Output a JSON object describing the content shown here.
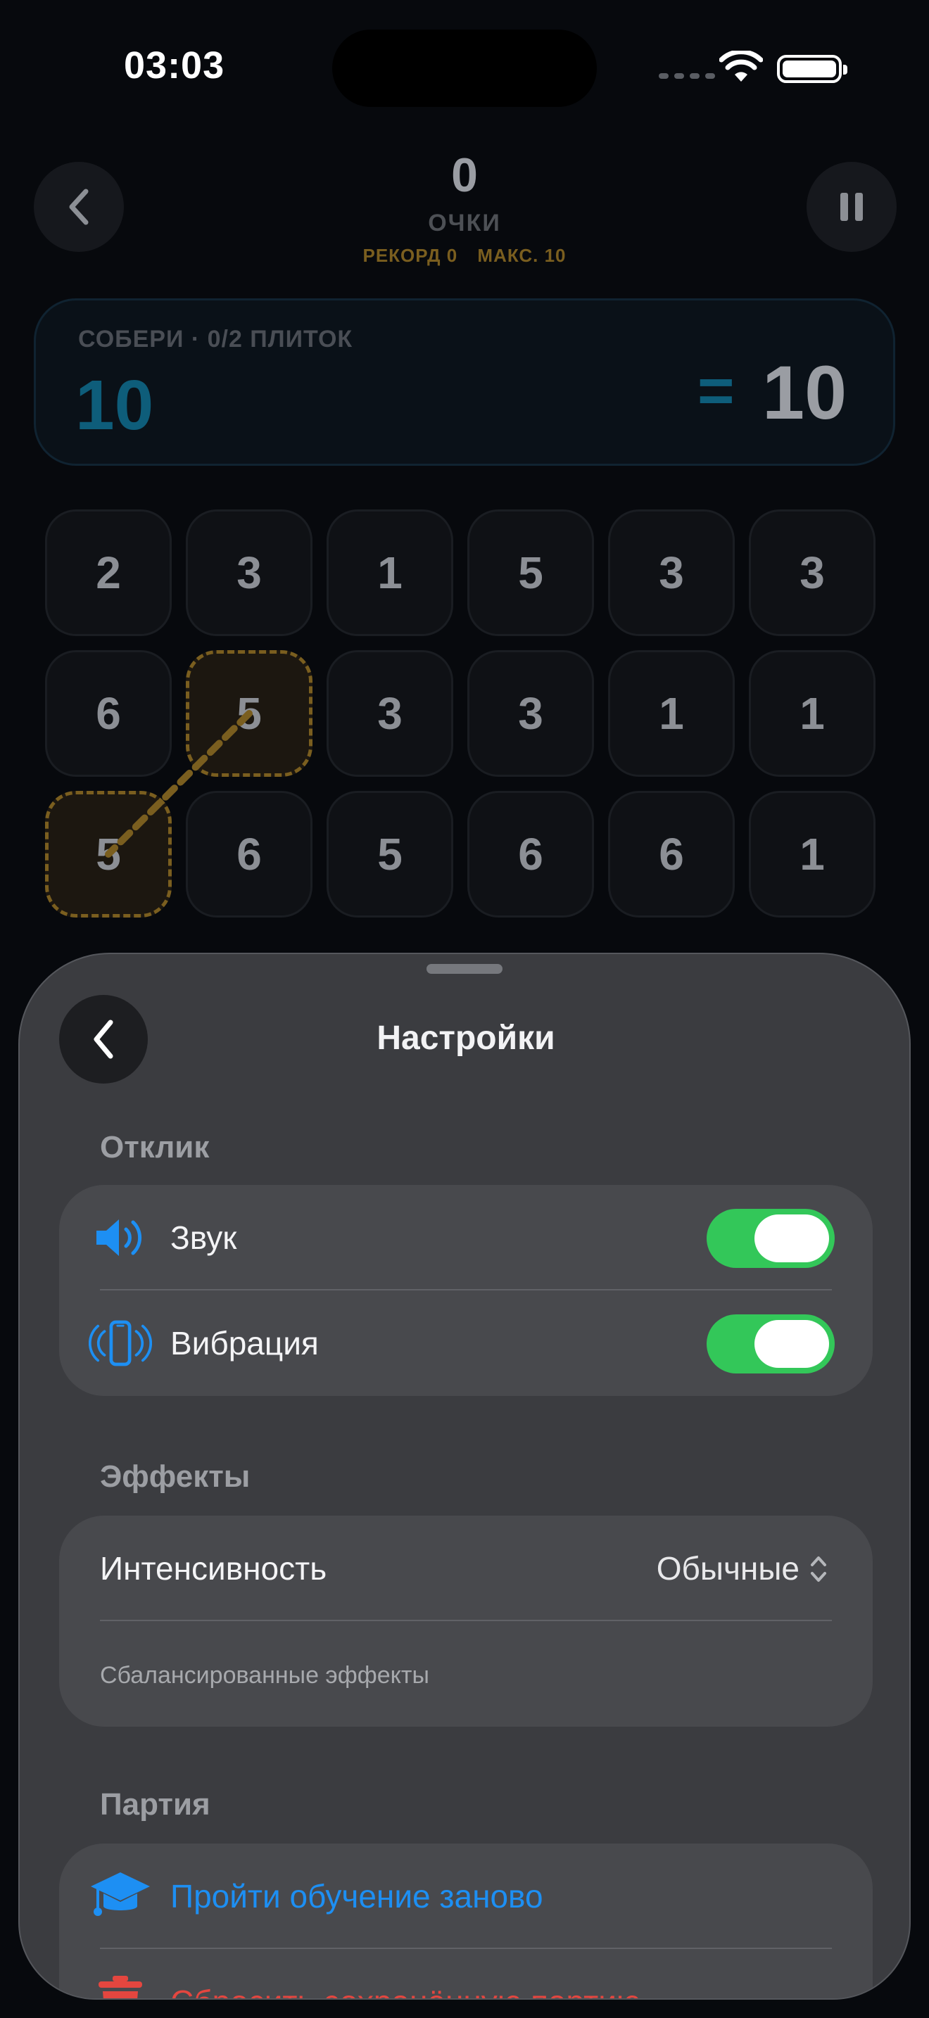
{
  "status_bar": {
    "time": "03:03"
  },
  "header": {
    "score": "0",
    "score_label": "ОЧКИ",
    "record": "РЕКОРД 0",
    "max": "МАКС. 10"
  },
  "target": {
    "caption": "СОБЕРИ · 0/2 ПЛИТОК",
    "value": "10",
    "equals": "=",
    "sum": "10"
  },
  "grid": {
    "rows": [
      [
        "2",
        "3",
        "1",
        "5",
        "3",
        "3"
      ],
      [
        "6",
        "5",
        "3",
        "3",
        "1",
        "1"
      ],
      [
        "5",
        "6",
        "5",
        "6",
        "6",
        "1"
      ]
    ],
    "selected": [
      [
        1,
        1
      ],
      [
        2,
        0
      ]
    ]
  },
  "settings": {
    "title": "Настройки",
    "feedback": {
      "section": "Отклик",
      "sound_label": "Звук",
      "sound_on": true,
      "vibration_label": "Вибрация",
      "vibration_on": true
    },
    "effects": {
      "section": "Эффекты",
      "intensity_label": "Интенсивность",
      "intensity_value": "Обычные",
      "note": "Сбалансированные эффекты"
    },
    "game": {
      "section": "Партия",
      "tutorial_label": "Пройти обучение заново",
      "reset_label": "Сбросить сохранённую партию"
    }
  },
  "colors": {
    "accent_blue": "#1d8ff3",
    "toggle_green": "#33c759",
    "destructive_red": "#e4463f",
    "selection_gold": "#7a5e1f"
  }
}
